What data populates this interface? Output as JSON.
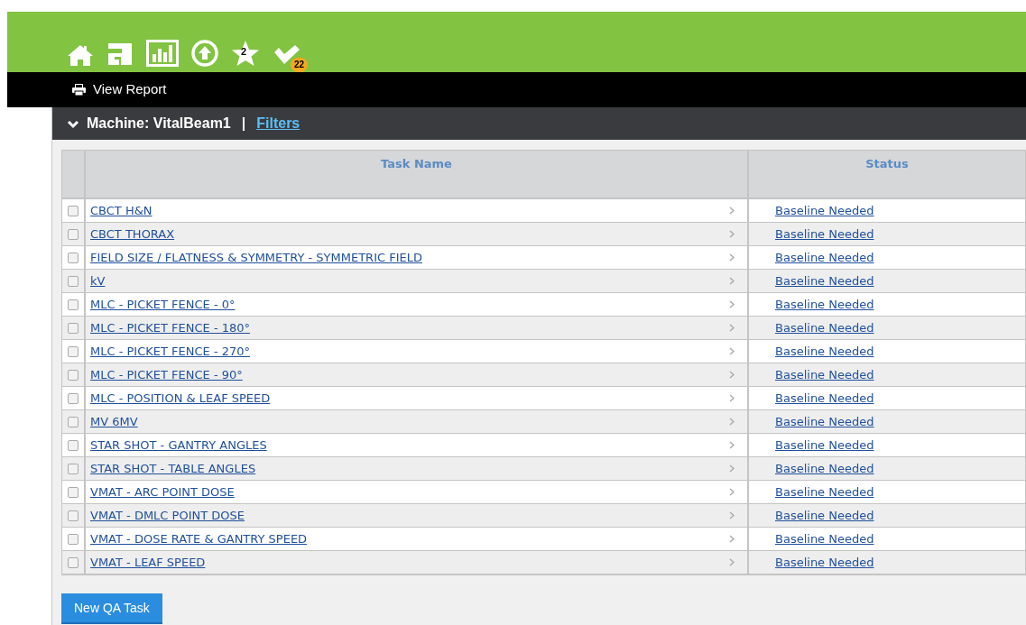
{
  "nav_icons": [
    {
      "kind": "home"
    },
    {
      "kind": "route"
    },
    {
      "kind": "chart"
    },
    {
      "kind": "upload"
    },
    {
      "kind": "star",
      "badge": "2"
    },
    {
      "kind": "check",
      "badge": "22"
    }
  ],
  "toolbar": {
    "action": "View Report"
  },
  "panel": {
    "title": "Machine: VitalBeam1",
    "separator": "|",
    "filters_link": "Filters",
    "expanded": true
  },
  "table": {
    "columns": [
      "Task Name",
      "Status"
    ],
    "rows": [
      {
        "task": "CBCT H&N",
        "status": "Baseline Needed",
        "checked": false
      },
      {
        "task": "CBCT THORAX",
        "status": "Baseline Needed",
        "checked": false
      },
      {
        "task": "FIELD SIZE / FLATNESS & SYMMETRY - SYMMETRIC FIELD",
        "status": "Baseline Needed",
        "checked": false
      },
      {
        "task": "kV",
        "status": "Baseline Needed",
        "checked": false
      },
      {
        "task": "MLC - PICKET FENCE - 0°",
        "status": "Baseline Needed",
        "checked": false
      },
      {
        "task": "MLC - PICKET FENCE - 180°",
        "status": "Baseline Needed",
        "checked": false
      },
      {
        "task": "MLC - PICKET FENCE - 270°",
        "status": "Baseline Needed",
        "checked": false
      },
      {
        "task": "MLC - PICKET FENCE - 90°",
        "status": "Baseline Needed",
        "checked": false
      },
      {
        "task": "MLC - POSITION & LEAF SPEED",
        "status": "Baseline Needed",
        "checked": false
      },
      {
        "task": "MV 6MV",
        "status": "Baseline Needed",
        "checked": false
      },
      {
        "task": "STAR SHOT - GANTRY ANGLES",
        "status": "Baseline Needed",
        "checked": false
      },
      {
        "task": "STAR SHOT - TABLE ANGLES",
        "status": "Baseline Needed",
        "checked": false
      },
      {
        "task": "VMAT - ARC POINT DOSE",
        "status": "Baseline Needed",
        "checked": false
      },
      {
        "task": "VMAT - DMLC POINT DOSE",
        "status": "Baseline Needed",
        "checked": false
      },
      {
        "task": "VMAT - DOSE RATE & GANTRY SPEED",
        "status": "Baseline Needed",
        "checked": false
      },
      {
        "task": "VMAT - LEAF SPEED",
        "status": "Baseline Needed",
        "checked": false
      }
    ]
  },
  "new_button": "New QA Task"
}
